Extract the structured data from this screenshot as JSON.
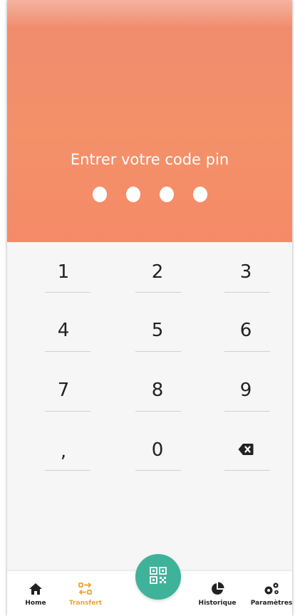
{
  "pin": {
    "title": "Entrer votre code pin",
    "entered_digits": 4
  },
  "keypad": {
    "keys": [
      "1",
      "2",
      "3",
      "4",
      "5",
      "6",
      "7",
      "8",
      "9",
      ",",
      "0",
      "backspace"
    ]
  },
  "nav": {
    "items": [
      {
        "label": "Home",
        "icon": "home-icon"
      },
      {
        "label": "Transfert",
        "icon": "transfer-icon",
        "active": true
      },
      {
        "label": "Historique",
        "icon": "pie-chart-icon"
      },
      {
        "label": "Paramètres",
        "icon": "gears-icon"
      }
    ],
    "center_button_icon": "qr-code-icon"
  },
  "colors": {
    "header": "#f39169",
    "accent_active": "#f0a32c",
    "fab": "#3fb39a"
  }
}
